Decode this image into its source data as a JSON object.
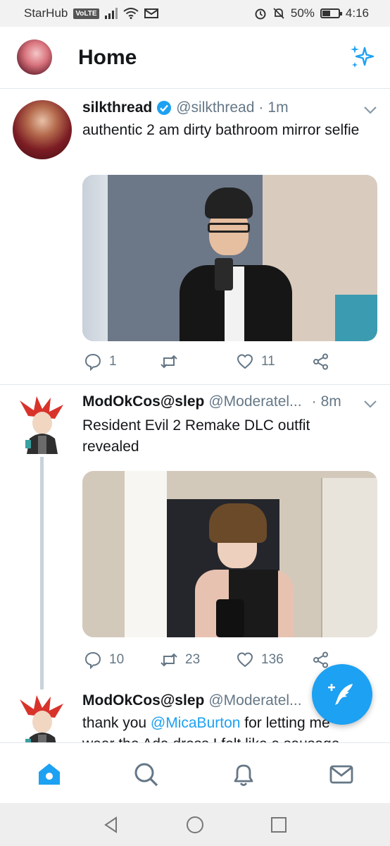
{
  "status_bar": {
    "carrier": "StarHub",
    "volte": "VoLTE",
    "battery": "50%",
    "battery_level": 0.5,
    "time": "4:16"
  },
  "header": {
    "title": "Home",
    "sparkle_icon": "sparkle-icon"
  },
  "tweets": [
    {
      "name": "silkthread",
      "verified": true,
      "handle": "@silkthread",
      "separator": "·",
      "time": "1m",
      "text": "authentic 2 am dirty bathroom mirror selfie",
      "replies": "1",
      "retweets": "",
      "likes": "11"
    },
    {
      "name": "ModOkCos@slep",
      "handle": "@Moderatel...",
      "separator": "·",
      "time": "8m",
      "text": "Resident Evil 2 Remake DLC outfit revealed",
      "replies": "10",
      "retweets": "23",
      "likes": "136"
    },
    {
      "name": "ModOkCos@slep",
      "handle": "@Moderatel...",
      "text_before": "thank you ",
      "mention": "@MicaBurton",
      "text_after": " for letting me wear the Ada dress I felt like a sausage"
    }
  ],
  "colors": {
    "accent": "#1da1f2",
    "text": "#14171a",
    "muted": "#657786",
    "divider": "#e1e8ed"
  },
  "icons": {
    "reply": "reply-icon",
    "retweet": "retweet-icon",
    "like": "heart-icon",
    "share": "share-icon",
    "compose": "compose-tweet-icon",
    "nav": [
      "home-icon",
      "search-icon",
      "notifications-bell-icon",
      "messages-envelope-icon"
    ],
    "system_nav": [
      "back-icon",
      "home-circle-icon",
      "recents-square-icon"
    ]
  }
}
